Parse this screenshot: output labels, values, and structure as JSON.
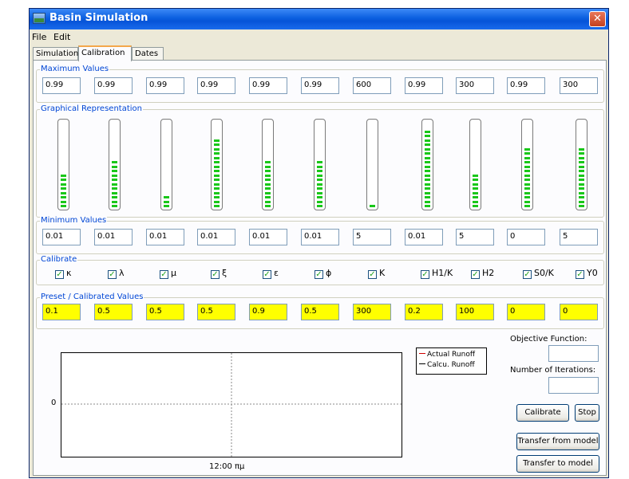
{
  "window": {
    "title": "Basin Simulation",
    "close_glyph": "✕"
  },
  "menu": [
    "File",
    "Edit"
  ],
  "tabs": [
    "Simulation",
    "Calibration",
    "Dates"
  ],
  "groups": {
    "max": "Maximum Values",
    "graph": "Graphical Representation",
    "min": "Minimum Values",
    "calibrate": "Calibrate",
    "preset": "Preset / Calibrated Values"
  },
  "max_values": [
    "0.99",
    "0.99",
    "0.99",
    "0.99",
    "0.99",
    "0.99",
    "600",
    "0.99",
    "300",
    "0.99",
    "300"
  ],
  "min_values": [
    "0.01",
    "0.01",
    "0.01",
    "0.01",
    "0.01",
    "0.01",
    "5",
    "0.01",
    "5",
    "0",
    "5"
  ],
  "preset_values": [
    "0.1",
    "0.5",
    "0.5",
    "0.5",
    "0.9",
    "0.5",
    "300",
    "0.2",
    "100",
    "0",
    "0"
  ],
  "bar_levels": [
    0.38,
    0.54,
    0.16,
    0.79,
    0.54,
    0.54,
    0.07,
    0.92,
    0.38,
    0.7,
    0.7
  ],
  "calibrate_params": [
    {
      "label": "κ",
      "checked": true
    },
    {
      "label": "λ",
      "checked": true
    },
    {
      "label": "μ",
      "checked": true
    },
    {
      "label": "ξ",
      "checked": true
    },
    {
      "label": "ε",
      "checked": true
    },
    {
      "label": "ϕ",
      "checked": true
    },
    {
      "label": "K",
      "checked": true
    },
    {
      "label": "H1/K",
      "checked": true
    },
    {
      "label": "H2",
      "checked": true
    },
    {
      "label": "S0/K",
      "checked": true
    },
    {
      "label": "Y0",
      "checked": true
    }
  ],
  "plot": {
    "y_tick": "0",
    "x_tick": "12:00 πμ"
  },
  "legend": [
    {
      "label": "Actual Runoff",
      "color": "#d00000"
    },
    {
      "label": "Calcu. Runoff",
      "color": "#000000"
    }
  ],
  "side": {
    "objective_label": "Objective Function:",
    "objective_value": "",
    "iterations_label": "Number of Iterations:",
    "iterations_value": "",
    "calibrate_button": "Calibrate",
    "stop_button": "Stop",
    "transfer_from_button": "Transfer from model",
    "transfer_to_button": "Transfer to model"
  },
  "colors": {
    "bar_fill": "#19c719",
    "preset_fill": "#ffff00",
    "title_bar": "#0b5fe0"
  }
}
